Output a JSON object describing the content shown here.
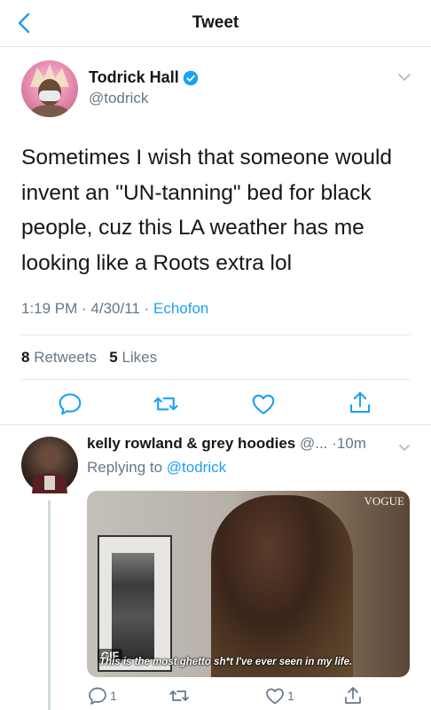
{
  "nav": {
    "title": "Tweet"
  },
  "tweet": {
    "author_name": "Todrick Hall",
    "author_handle": "@todrick",
    "text": "Sometimes I wish that someone would invent an \"UN-tanning\" bed for black people, cuz this LA weather has me looking like a Roots extra lol",
    "time": "1:19 PM · 4/30/11 · ",
    "source": "Echofon",
    "retweets_count": "8",
    "retweets_label": "Retweets",
    "likes_count": "5",
    "likes_label": "Likes"
  },
  "reply": {
    "author_name": "kelly rowland & grey hoodies",
    "author_handle": "@...",
    "time": "·10m",
    "replying_label": "Replying to ",
    "replying_to": "@todrick",
    "media": {
      "watermark": "VOGUE",
      "gif_badge": "GIF",
      "caption": "This is the most ghetto sh*t I've ever seen in my life."
    },
    "reply_count": "1",
    "like_count": "1"
  },
  "colors": {
    "accent": "#1da1f2",
    "secondary_text": "#657786",
    "divider": "#e1e8ed"
  },
  "icons": [
    "back-arrow-icon",
    "verified-badge-icon",
    "chevron-down-icon",
    "reply-icon",
    "retweet-icon",
    "like-icon",
    "share-icon"
  ]
}
